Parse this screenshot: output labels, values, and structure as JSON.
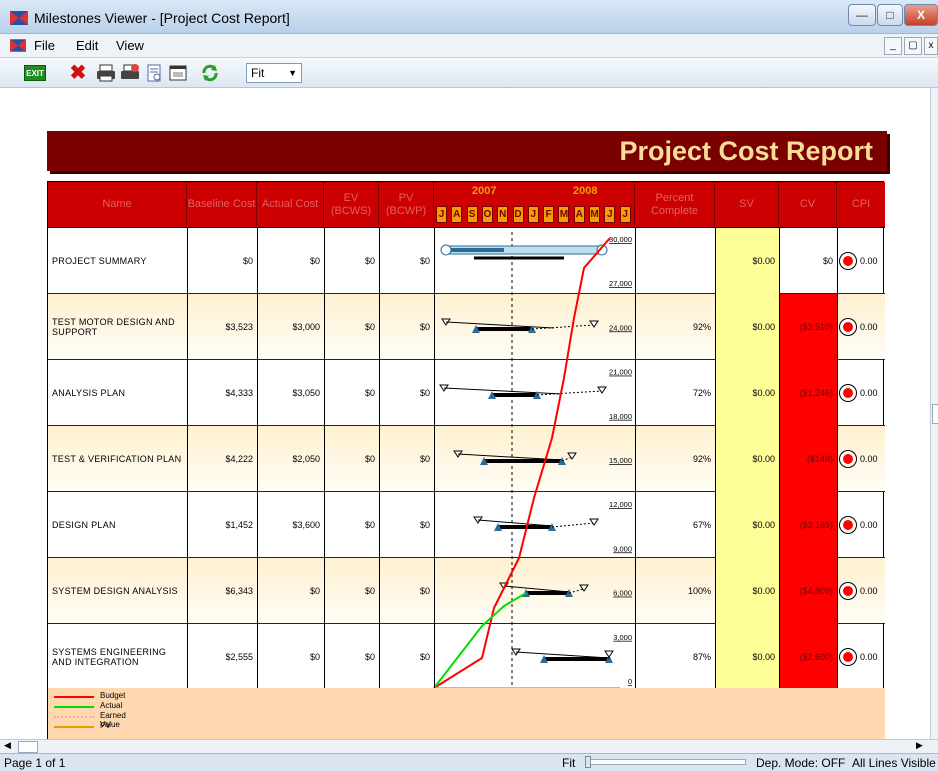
{
  "window": {
    "title": "Milestones Viewer - [Project Cost Report]",
    "minimize": "—",
    "maximize": "□",
    "close": "X"
  },
  "menu": {
    "file": "File",
    "edit": "Edit",
    "view": "View"
  },
  "toolbar": {
    "exit": "EXIT",
    "zoom_value": "Fit"
  },
  "report": {
    "title": "Project Cost Report",
    "headers": {
      "name": "Name",
      "baseline": "Baseline Cost",
      "actual": "Actual Cost",
      "ev": "EV (BCWS)",
      "pv": "PV (BCWP)",
      "percent": "Percent Complete",
      "sv": "SV",
      "cv": "CV",
      "cpi": "CPI"
    },
    "years": [
      "2007",
      "2008"
    ],
    "months": [
      "J",
      "A",
      "S",
      "O",
      "N",
      "D",
      "J",
      "F",
      "M",
      "A",
      "M",
      "J",
      "J"
    ],
    "axis_labels": [
      "30,000",
      "27,000",
      "24,000",
      "21,000",
      "18,000",
      "15,000",
      "12,000",
      "9,000",
      "6,000",
      "3,000",
      "0"
    ],
    "rows": [
      {
        "name": "PROJECT SUMMARY",
        "baseline": "$0",
        "actual": "$0",
        "ev": "$0",
        "pv": "$0",
        "percent": "",
        "sv": "$0.00",
        "cv": "$0",
        "cpi": "0.00",
        "cv_neg": false
      },
      {
        "name": "TEST MOTOR DESIGN AND SUPPORT",
        "baseline": "$3,523",
        "actual": "$3,000",
        "ev": "$0",
        "pv": "$0",
        "percent": "92%",
        "sv": "$0.00",
        "cv": "($3,510)",
        "cpi": "0.00",
        "cv_neg": true
      },
      {
        "name": "ANALYSIS PLAN",
        "baseline": "$4,333",
        "actual": "$3,050",
        "ev": "$0",
        "pv": "$0",
        "percent": "72%",
        "sv": "$0.00",
        "cv": "($1,246)",
        "cpi": "0.00",
        "cv_neg": true
      },
      {
        "name": "TEST & VERIFICATION PLAN",
        "baseline": "$4,222",
        "actual": "$2,050",
        "ev": "$0",
        "pv": "$0",
        "percent": "92%",
        "sv": "$0.00",
        "cv": "($149)",
        "cpi": "0.00",
        "cv_neg": true
      },
      {
        "name": "DESIGN PLAN",
        "baseline": "$1,452",
        "actual": "$3,600",
        "ev": "$0",
        "pv": "$0",
        "percent": "67%",
        "sv": "$0.00",
        "cv": "($3,169)",
        "cpi": "0.00",
        "cv_neg": true
      },
      {
        "name": "SYSTEM DESIGN ANALYSIS",
        "baseline": "$6,343",
        "actual": "$0",
        "ev": "$0",
        "pv": "$0",
        "percent": "100%",
        "sv": "$0.00",
        "cv": "($4,809)",
        "cpi": "0.00",
        "cv_neg": true
      },
      {
        "name": "SYSTEMS ENGINEERING AND INTEGRATION",
        "baseline": "$2,555",
        "actual": "$0",
        "ev": "$0",
        "pv": "$0",
        "percent": "87%",
        "sv": "$0.00",
        "cv": "($2,600)",
        "cpi": "0.00",
        "cv_neg": true
      }
    ],
    "legend": [
      {
        "label": "Budget",
        "color": "#ff0000",
        "style": "solid"
      },
      {
        "label": "Actual",
        "color": "#00dd00",
        "style": "solid"
      },
      {
        "label": "Earned Value",
        "color": "#ffaaaa",
        "style": "dotted"
      },
      {
        "label": "PV",
        "color": "#e0a000",
        "style": "solid"
      }
    ]
  },
  "status": {
    "page": "Page 1 of 1",
    "zoom": "Fit",
    "dep_mode": "Dep. Mode: OFF",
    "lines": "All Lines Visible"
  },
  "colors": {
    "report_title_bg": "#7a0000",
    "header_bg": "#cc0000",
    "sv_bg": "#ffff99",
    "cv_negative": "#ff0000",
    "cpi_indicator": "#ff0000"
  }
}
